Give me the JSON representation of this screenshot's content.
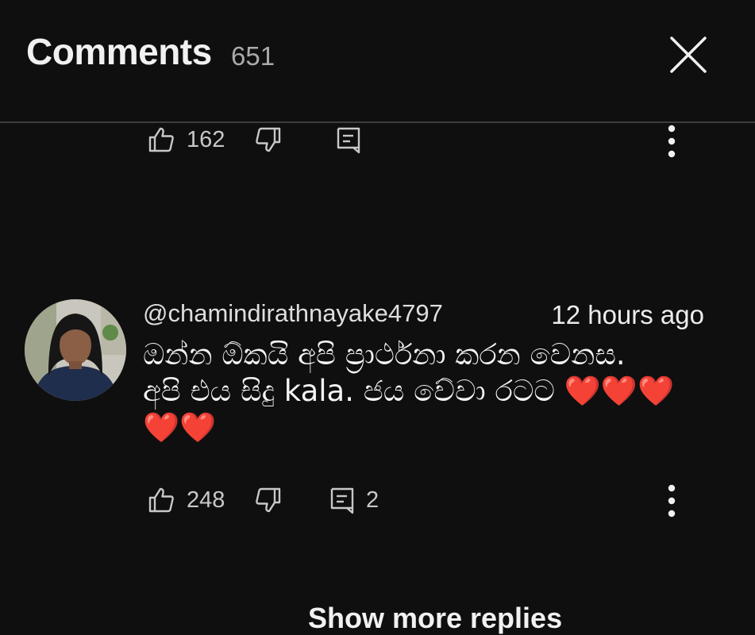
{
  "header": {
    "title": "Comments",
    "count": "651"
  },
  "comment_prev": {
    "likes": "162"
  },
  "comment": {
    "author": "@chamindirathnayake4797",
    "time": "12 hours ago",
    "text_line1": "ඔන්න ඕකයි අපි ප්‍රාර්ථනා කරන වෙනස.",
    "text_line2_start": "අපි එය සිදු kala. ජය වේවා රටට ",
    "hearts_a": "❤️❤️❤️",
    "hearts_b": "❤️❤️",
    "likes": "248",
    "replies": "2"
  },
  "footer": {
    "show_more_label": "Show more replies"
  },
  "colors": {
    "background": "#0f0f0f",
    "text": "#f1f1f1",
    "muted": "#aaaaaa",
    "heart": "#e0242f"
  },
  "icons": [
    "close-icon",
    "thumbs-up-icon",
    "thumbs-down-icon",
    "reply-icon",
    "more-vertical-icon"
  ]
}
